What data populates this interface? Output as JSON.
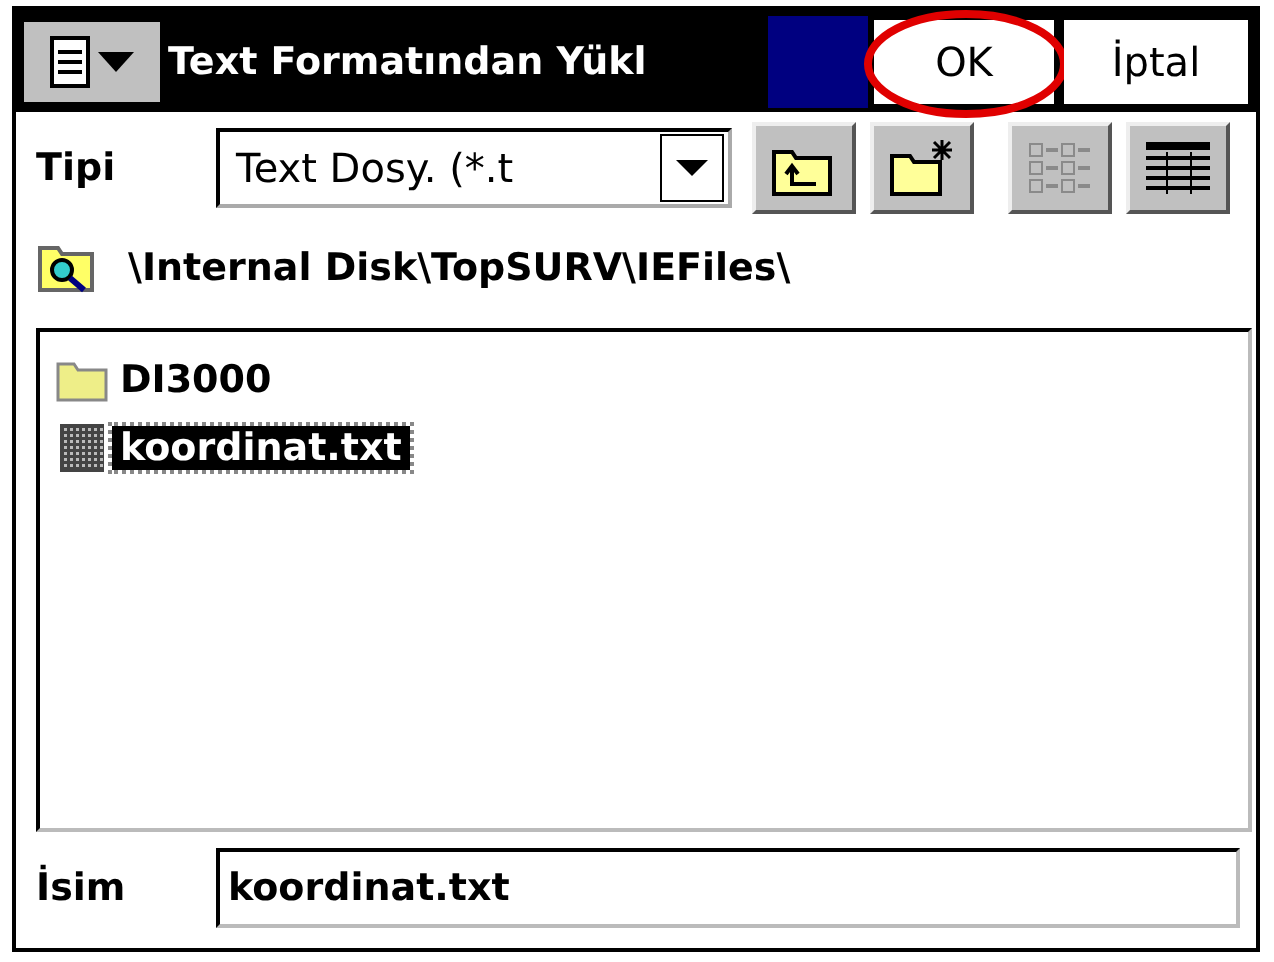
{
  "title_bar": {
    "title": "Text Formatından Yükl",
    "buttons": [
      {
        "label": "OK",
        "highlighted": true
      },
      {
        "label": "İptal",
        "highlighted": false
      }
    ]
  },
  "type_row": {
    "label": "Tipi",
    "dropdown": {
      "value": "Text Dosy. (*.t"
    },
    "toolbar": [
      {
        "kind": "up-folder",
        "disabled": false
      },
      {
        "kind": "new-folder",
        "disabled": false
      },
      {
        "kind": "list-view",
        "disabled": true
      },
      {
        "kind": "details-view",
        "disabled": false
      }
    ]
  },
  "path": "\\Internal Disk\\TopSURV\\IEFiles\\",
  "files": [
    {
      "name": "DI3000",
      "kind": "folder",
      "selected": false
    },
    {
      "name": "koordinat.txt",
      "kind": "file",
      "selected": true
    }
  ],
  "name_field": {
    "label": "İsim",
    "value": "koordinat.txt"
  }
}
